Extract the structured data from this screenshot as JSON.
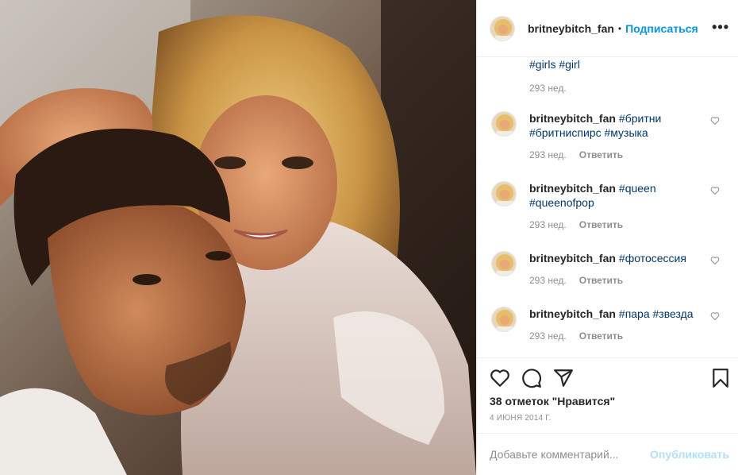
{
  "post": {
    "username": "britneybitch_fan",
    "separator": "•",
    "follow_label": "Подписаться",
    "more_label": "•••"
  },
  "caption_tail": {
    "tags": [
      "#girls",
      "#girl"
    ],
    "time": "293 нед."
  },
  "comments": [
    {
      "username": "britneybitch_fan",
      "line1": "#бритни",
      "line2": "#бритниспирс #музыка",
      "time": "293 нед.",
      "reply": "Ответить"
    },
    {
      "username": "britneybitch_fan",
      "line1": "#queen",
      "line2": "#queenofpop",
      "time": "293 нед.",
      "reply": "Ответить"
    },
    {
      "username": "britneybitch_fan",
      "line1": "#фотосессия",
      "line2": "",
      "time": "293 нед.",
      "reply": "Ответить"
    },
    {
      "username": "britneybitch_fan",
      "line1": "#пара #звезда",
      "line2": "",
      "time": "293 нед.",
      "reply": "Ответить"
    }
  ],
  "actions": {
    "likes_text": "38 отметок \"Нравится\"",
    "date": "4 ИЮНЯ 2014 Г."
  },
  "add_comment": {
    "placeholder": "Добавьте комментарий...",
    "post_label": "Опубликовать"
  },
  "icons": [
    "heart-icon",
    "comment-icon",
    "share-icon",
    "bookmark-icon",
    "more-icon"
  ],
  "colors": {
    "accent": "#0095f6",
    "tag": "#00376b",
    "muted": "#8e8e8e",
    "post_disabled": "#b2dffc"
  }
}
